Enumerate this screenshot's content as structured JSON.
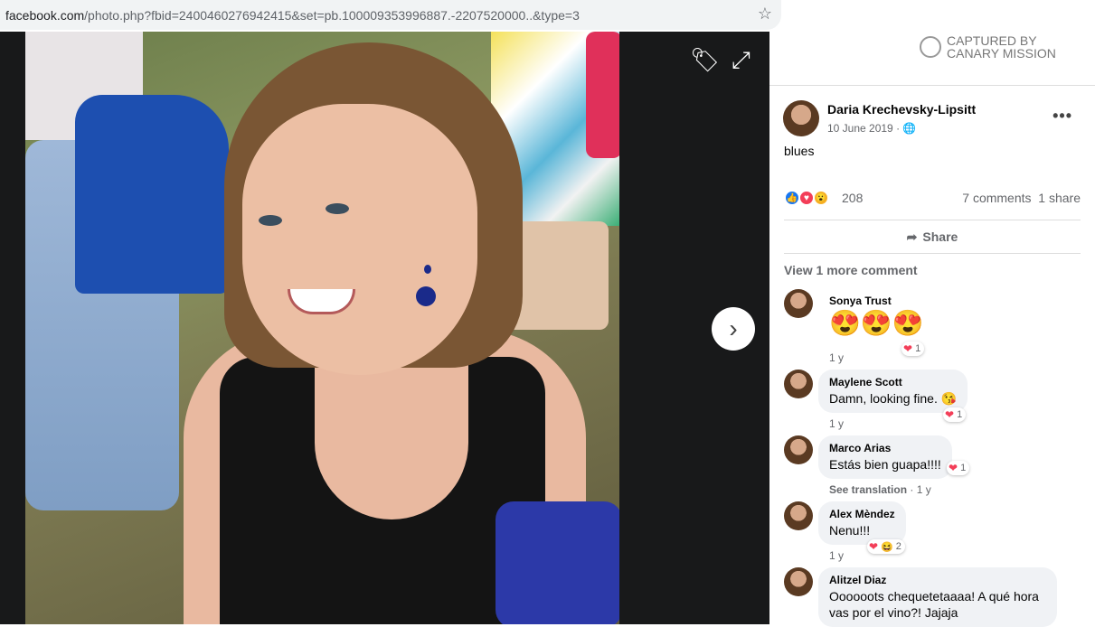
{
  "address_bar": {
    "host": "facebook.com",
    "path": "/photo.php?fbid=2400460276942415&set=pb.100009353996887.-2207520000..&type=3"
  },
  "watermark": {
    "line1": "CAPTURED BY",
    "line2": "CANARY MISSION"
  },
  "post": {
    "author": "Daria Krechevsky-Lipsitt",
    "date": "10 June 2019 · ",
    "caption": "blues",
    "reaction_count": "208",
    "comments_count": "7 comments",
    "shares_count": "1 share",
    "share_label": "Share",
    "view_more": "View 1 more comment"
  },
  "comments": [
    {
      "name": "Sonya Trust",
      "text": "😍😍😍",
      "time": "1 y",
      "reactions": "1"
    },
    {
      "name": "Maylene Scott",
      "text": "Damn, looking fine. 😘",
      "time": "1 y",
      "reactions": "1"
    },
    {
      "name": "Marco Arias",
      "text": "Estás bien guapa!!!!",
      "time": "1 y",
      "see_translation": "See translation",
      "reactions": "1"
    },
    {
      "name": "Alex Mèndez",
      "text": "Nenu!!!",
      "time": "1 y",
      "reactions": "2"
    },
    {
      "name": "Alitzel Diaz",
      "text": "Oooooots chequetetaaaa! A qué hora vas por el vino?! Jajaja"
    }
  ],
  "icons": [
    "star-icon",
    "tag-icon",
    "expand-icon",
    "next-arrow-icon",
    "globe-icon",
    "more-icon",
    "share-icon",
    "like-icon",
    "love-icon",
    "wow-icon"
  ]
}
